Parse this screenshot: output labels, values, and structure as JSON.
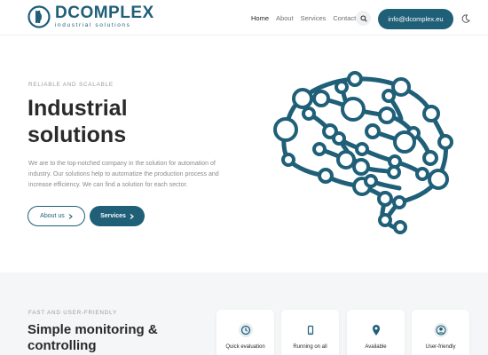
{
  "brand": {
    "name": "DCOMPLEX",
    "tagline": "industrial solutions"
  },
  "nav": {
    "items": [
      "Home",
      "About",
      "Services",
      "Contact"
    ],
    "active": "Home",
    "email_label": "info@dcomplex.eu"
  },
  "hero": {
    "kicker": "RELIABLE AND SCALABLE",
    "title_line1": "Industrial",
    "title_line2": "solutions",
    "description": "We are to the top-notched company in the solution for automation of industry. Our solutions help to automatize the production process and increase efficiency. We can find a solution for each sector.",
    "about_label": "About us",
    "services_label": "Services"
  },
  "features": {
    "kicker": "FAST AND USER-FRIENDLY",
    "title_line1": "Simple monitoring &",
    "title_line2": "controlling",
    "cards": [
      {
        "label": "Quick evaluation",
        "icon": "clock-icon"
      },
      {
        "label": "Running on all",
        "icon": "mobile-icon"
      },
      {
        "label": "Available",
        "icon": "location-pin-icon"
      },
      {
        "label": "User-friendly",
        "icon": "user-icon"
      }
    ]
  },
  "colors": {
    "accent": "#1f5f78",
    "section_bg": "#f5f6f7"
  }
}
